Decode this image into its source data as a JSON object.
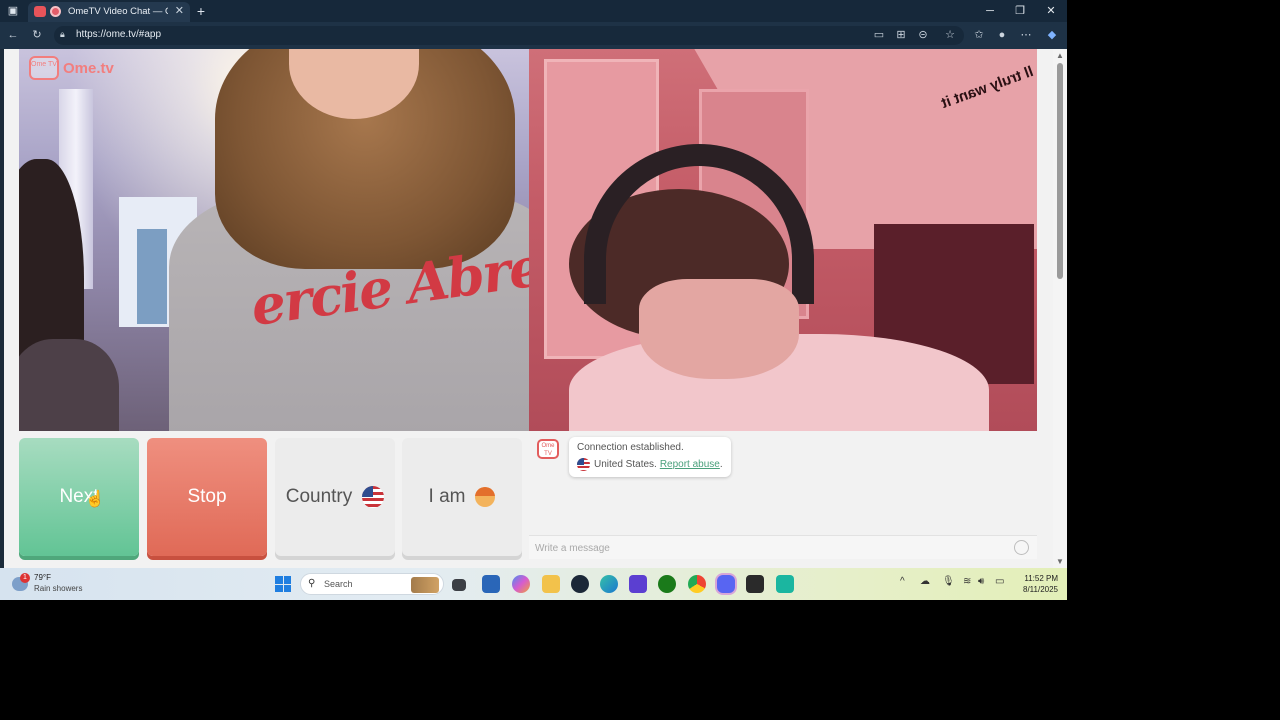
{
  "browser": {
    "tab_title": "OmeTV Video Chat — Omegl",
    "url": "https://ome.tv/#app"
  },
  "app": {
    "brand_text": "Ome.tv",
    "brand_badge": "Ome TV",
    "video_left_shirt_text": "ercie Abre",
    "video_right_wall_text": "ll truly want it"
  },
  "controls": {
    "next_label": "Next",
    "stop_label": "Stop",
    "country_label": "Country",
    "iam_label": "I am"
  },
  "chat": {
    "avatar_label": "Ome TV",
    "status_line": "Connection established.",
    "country": "United States.",
    "report_link": "Report abuse",
    "report_suffix": ".",
    "input_placeholder": "Write a message"
  },
  "taskbar": {
    "weather_badge": "1",
    "weather_temp": "79°F",
    "weather_condition": "Rain showers",
    "search_label": "Search",
    "time": "11:52 PM",
    "date": "8/11/2025"
  },
  "colors": {
    "next_green": "#62c495",
    "stop_red": "#e06a57",
    "brand": "#f27e7e",
    "link_green": "#4aa07c"
  }
}
